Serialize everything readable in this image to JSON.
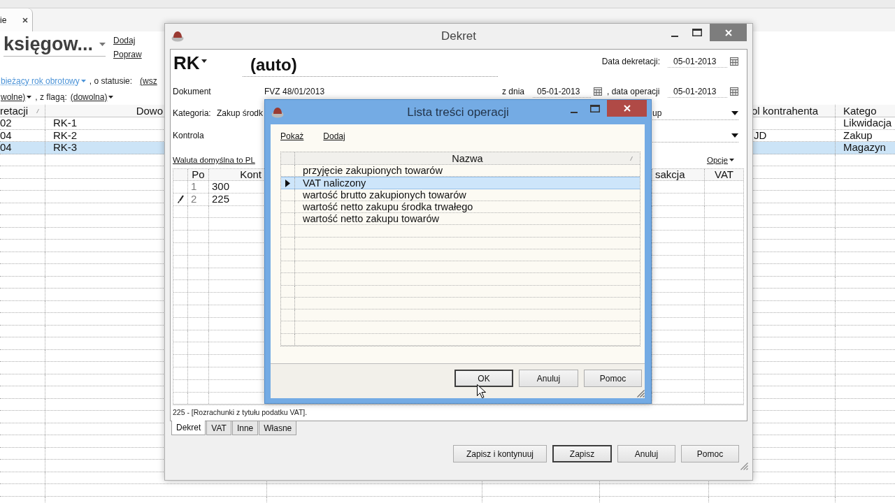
{
  "app": {
    "tab": {
      "label": "ie"
    },
    "title": "księgow...",
    "actions": [
      "Dodaj",
      "Popraw"
    ],
    "filters": [
      [
        {
          "kind": "dropdown",
          "text": "bieżący rok obrotowy",
          "highlighted": true
        },
        {
          "kind": "text",
          "text": ", o statusie:"
        },
        {
          "kind": "link",
          "text": "(wsz"
        }
      ],
      [
        {
          "kind": "dropdown",
          "text": "wolne)",
          "highlighted": false
        },
        {
          "kind": "text",
          "text": ", z flagą:"
        },
        {
          "kind": "dropdown",
          "text": "(dowolna)",
          "highlighted": false
        }
      ]
    ],
    "table": {
      "columns": [
        "retacji",
        "Dowo",
        "ol kontrahenta",
        "Katego"
      ],
      "rows": [
        {
          "column_1": "02",
          "column_2": "RK-1",
          "column_4": "Likwidacja",
          "selected": false
        },
        {
          "column_1": "04",
          "column_2": "RK-2",
          "column_3": "JD",
          "column_4": "Zakup",
          "selected": false
        },
        {
          "column_1": "04",
          "column_2": "RK-3",
          "column_4": "Magazyn",
          "selected": true
        }
      ]
    }
  },
  "dekret": {
    "title": "Dekret",
    "active": false,
    "doc_type": "RK",
    "number": "(auto)",
    "entry_date": {
      "label": "Data dekretacji:",
      "value": "05-01-2013"
    },
    "document": {
      "label": "Dokument",
      "value": "FVZ 48/01/2013",
      "date_label": "z dnia",
      "date_value": "05-01-2013",
      "operation_label": ", data operacji",
      "operation_value": "05-01-2013"
    },
    "category": {
      "label": "Kategoria:",
      "value": "Zakup środk",
      "field_2_value": "up"
    },
    "control": {
      "label": "Kontrola"
    },
    "currency_link": "Waluta domyślna to PL",
    "options_link": "Opcje",
    "grid": {
      "columns": [
        "Po",
        "Kont",
        "sakcja",
        "VAT"
      ],
      "rows": [
        {
          "column_1": "1",
          "column_2": "300",
          "editing": false
        },
        {
          "column_1": "2",
          "column_2": "225",
          "editing": true
        }
      ]
    },
    "account_note": "225 - [Rozrachunki z tytułu podatku VAT].",
    "tabs": [
      {
        "label": "Dekret",
        "selected": true
      },
      {
        "label": "VAT",
        "selected": false
      },
      {
        "label": "Inne",
        "selected": false
      },
      {
        "label": "Własne",
        "selected": false
      }
    ],
    "buttons": [
      {
        "label": "Zapisz i kontynuuj",
        "default": false
      },
      {
        "label": "Zapisz",
        "default": true
      },
      {
        "label": "Anuluj",
        "default": false
      },
      {
        "label": "Pomoc",
        "default": false
      }
    ]
  },
  "dialog": {
    "title": "Lista treści operacji",
    "active": true,
    "links": [
      "Pokaż",
      "Dodaj"
    ],
    "list": {
      "column": "Nazwa",
      "rows": [
        {
          "name": "przyjęcie zakupionych towarów",
          "selected": false
        },
        {
          "name": "VAT naliczony",
          "selected": true
        },
        {
          "name": "wartość brutto zakupionych towarów",
          "selected": false
        },
        {
          "name": "wartość netto zakupu środka trwałego",
          "selected": false
        },
        {
          "name": "wartość netto zakupu towarów",
          "selected": false
        }
      ]
    },
    "buttons": [
      {
        "label": "OK",
        "default": true
      },
      {
        "label": "Anuluj",
        "default": false
      },
      {
        "label": "Pomoc",
        "default": false
      }
    ]
  }
}
